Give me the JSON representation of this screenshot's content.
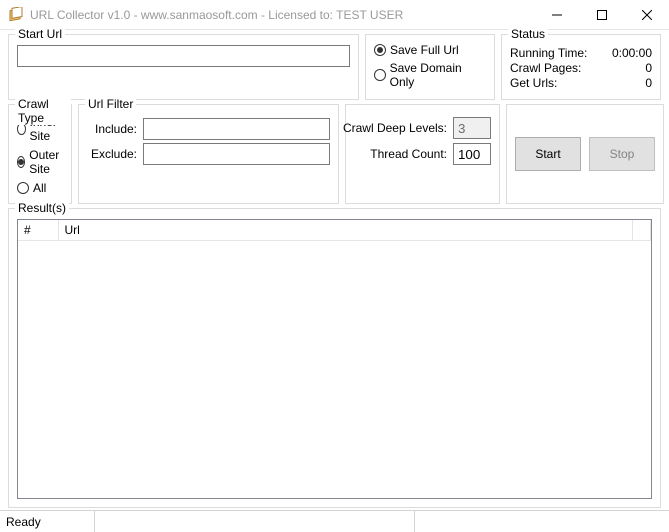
{
  "window": {
    "title": "URL Collector v1.0  - www.sanmaosoft.com - Licensed to: TEST USER"
  },
  "startUrl": {
    "legend": "Start Url",
    "value": ""
  },
  "saveMode": {
    "fullLabel": "Save Full Url",
    "domainLabel": "Save Domain Only",
    "selected": "full"
  },
  "status": {
    "legend": "Status",
    "runningTimeLabel": "Running Time:",
    "runningTime": "0:00:00",
    "crawlPagesLabel": "Crawl Pages:",
    "crawlPages": "0",
    "getUrlsLabel": "Get Urls:",
    "getUrls": "0"
  },
  "crawlType": {
    "legend": "Crawl Type",
    "innerLabel": "Inner Site",
    "outerLabel": "Outer Site",
    "allLabel": "All",
    "selected": "outer"
  },
  "urlFilter": {
    "legend": "Url Filter",
    "includeLabel": "Include:",
    "includeValue": "",
    "excludeLabel": "Exclude:",
    "excludeValue": ""
  },
  "params": {
    "deepLabel": "Crawl Deep Levels:",
    "deepValue": "3",
    "threadLabel": "Thread Count:",
    "threadValue": "100"
  },
  "buttons": {
    "start": "Start",
    "stop": "Stop"
  },
  "results": {
    "legend": "Result(s)",
    "cols": {
      "num": "#",
      "url": "Url"
    },
    "rows": []
  },
  "statusbar": {
    "text": "Ready"
  }
}
